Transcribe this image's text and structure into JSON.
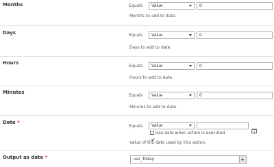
{
  "fields": [
    {
      "label": "Months",
      "operator": "Equals",
      "type": "Value",
      "value": "0",
      "help": "Months to add to date."
    },
    {
      "label": "Days",
      "operator": "Equals",
      "type": "Value",
      "value": "0",
      "help": "Days to add to date."
    },
    {
      "label": "Hours",
      "operator": "Equals",
      "type": "Value",
      "value": "0",
      "help": "Hours to add to date."
    },
    {
      "label": "Minutes",
      "operator": "Equals",
      "type": "Value",
      "value": "0",
      "help": "Minutes to add to date."
    }
  ],
  "date_field": {
    "label": "Date",
    "required_marker": "*",
    "operator": "Equals",
    "type": "Value",
    "value": "",
    "checkbox_label": "Use date when action is executed",
    "checkbox_checked": true,
    "help": "Value of the date used by this action."
  },
  "output_field": {
    "label": "Output as date",
    "required_marker": "*",
    "value": "var_Today"
  },
  "icons": {
    "calendar": "calendar-icon",
    "dropdown": "chevron-down-icon"
  }
}
